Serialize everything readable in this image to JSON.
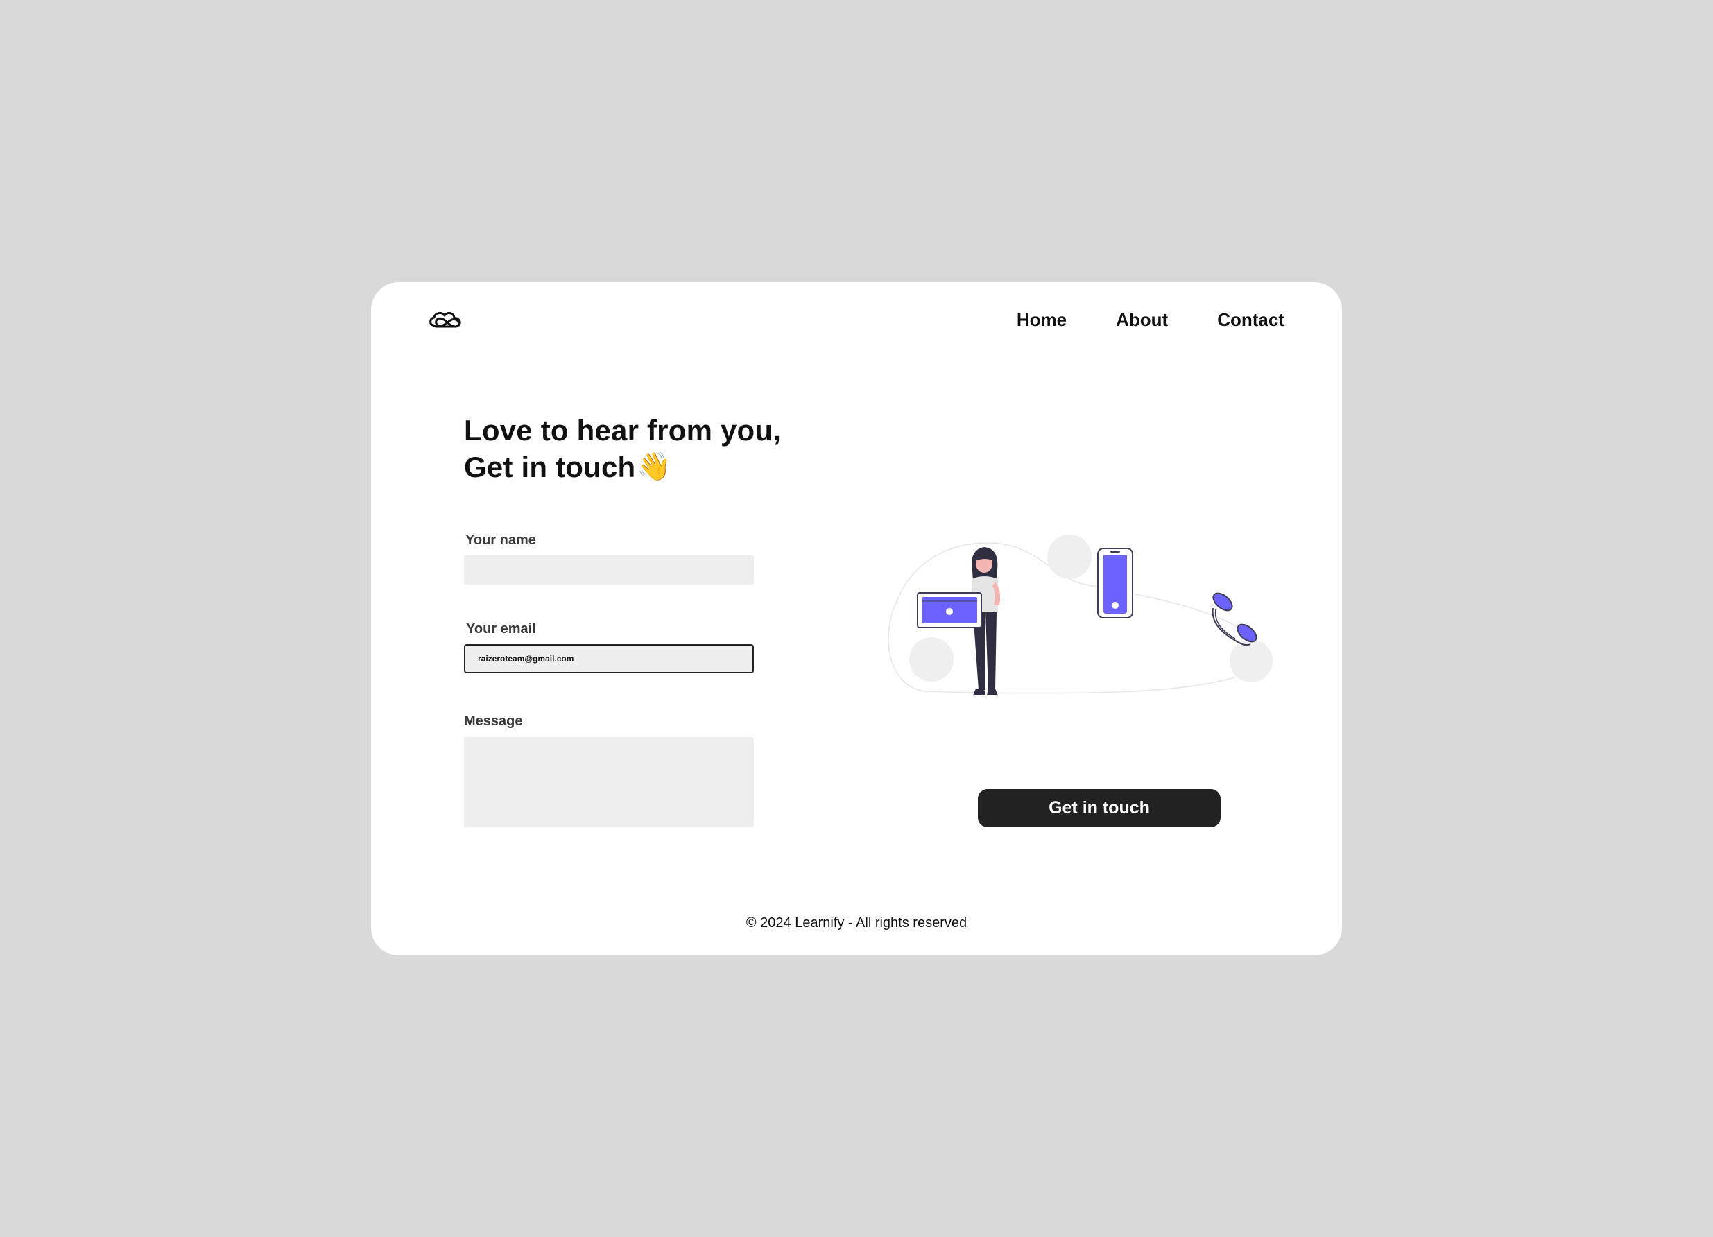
{
  "nav": {
    "logo_icon": "infinity-cloud-logo",
    "items": [
      {
        "label": "Home"
      },
      {
        "label": "About"
      },
      {
        "label": "Contact"
      }
    ]
  },
  "hero": {
    "line1": "Love to hear from you,",
    "line2": "Get in touch",
    "emoji": "👋",
    "emoji_icon": "waving-hand-icon"
  },
  "form": {
    "name_label": "Your name",
    "name_value": "",
    "email_label": "Your email",
    "email_value": "raizeroteam@gmail.com",
    "message_label": "Message",
    "message_value": ""
  },
  "cta": {
    "label": "Get in touch"
  },
  "footer": {
    "text": "© 2024 Learnify - All rights reserved"
  },
  "colors": {
    "page_bg": "#d9d9d9",
    "card_bg": "#ffffff",
    "field_bg": "#eeeeee",
    "accent": "#6c63ff",
    "button_bg": "#222222",
    "button_text": "#ffffff"
  }
}
